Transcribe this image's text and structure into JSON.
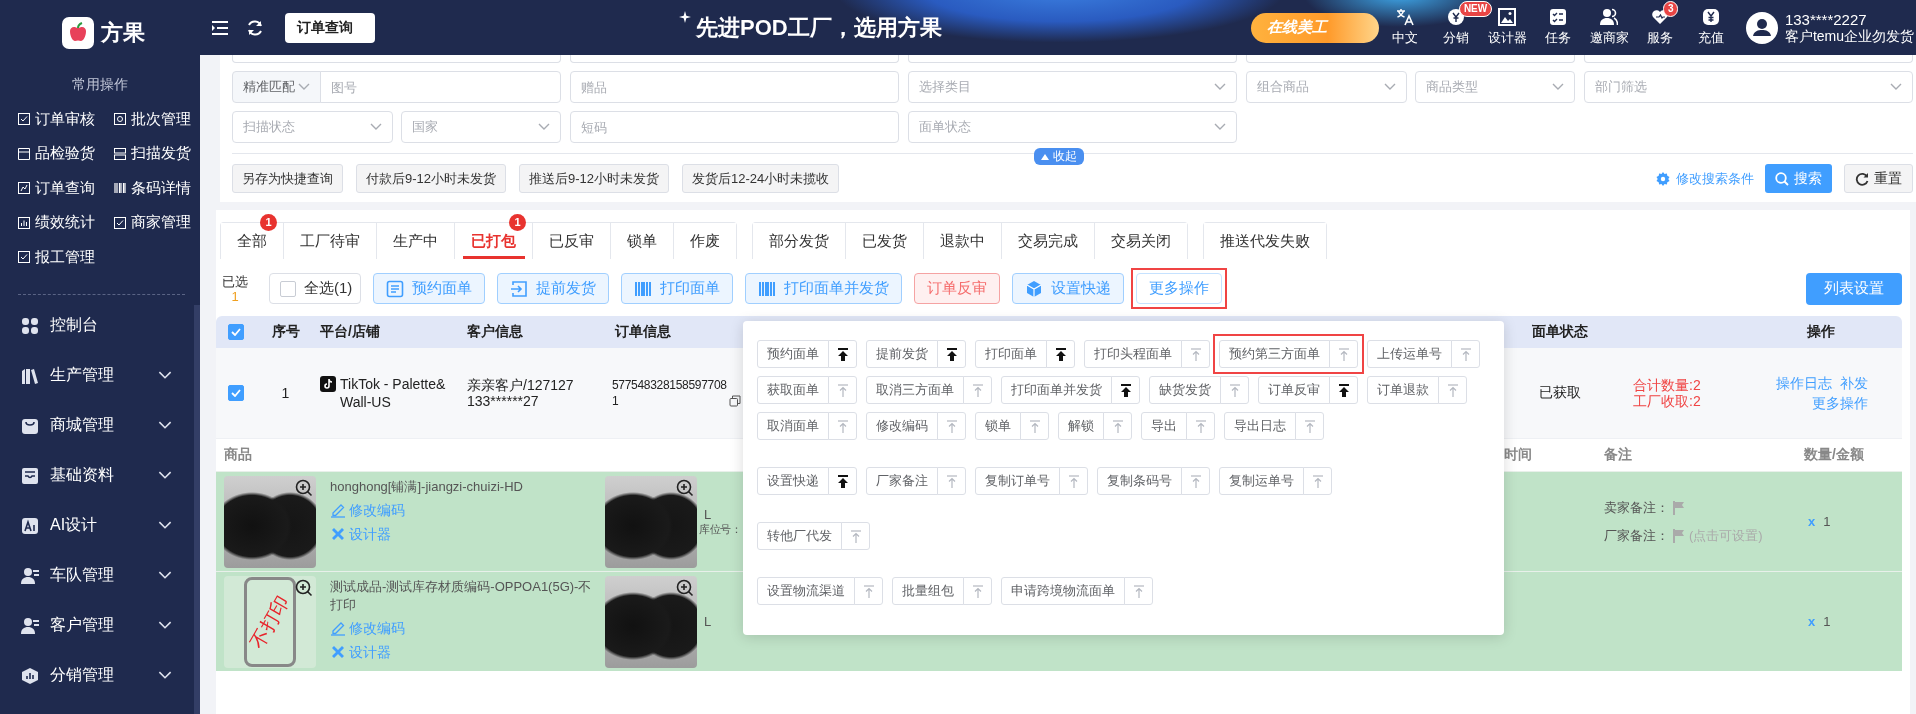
{
  "sidebar": {
    "brand": "方果",
    "section_title": "常用操作",
    "shortcuts": [
      {
        "label": "订单审核"
      },
      {
        "label": "批次管理"
      },
      {
        "label": "品检验货"
      },
      {
        "label": "扫描发货"
      },
      {
        "label": "订单查询"
      },
      {
        "label": "条码详情"
      },
      {
        "label": "绩效统计"
      },
      {
        "label": "商家管理"
      },
      {
        "label": "报工管理"
      }
    ],
    "menu": [
      {
        "label": "控制台",
        "expandable": false
      },
      {
        "label": "生产管理",
        "expandable": true
      },
      {
        "label": "商城管理",
        "expandable": true
      },
      {
        "label": "基础资料",
        "expandable": true
      },
      {
        "label": "AI设计",
        "expandable": true
      },
      {
        "label": "车队管理",
        "expandable": true
      },
      {
        "label": "客户管理",
        "expandable": true
      },
      {
        "label": "分销管理",
        "expandable": true
      }
    ]
  },
  "header": {
    "page_tab": "订单查询",
    "slogan": "先进POD工厂，选用方果",
    "promo": "在线美工",
    "tools": [
      {
        "label": "中文"
      },
      {
        "label": "分销",
        "badge": "NEW"
      },
      {
        "label": "设计器"
      },
      {
        "label": "任务"
      },
      {
        "label": "邀商家"
      },
      {
        "label": "服务",
        "badge": "3"
      },
      {
        "label": "充值"
      }
    ],
    "user": {
      "account": "133****2227",
      "company": "客户temu企业勿发货"
    }
  },
  "filters": {
    "rows": [
      [
        [
          {
            "kind": "cut"
          }
        ],
        [
          {
            "kind": "cut"
          }
        ],
        [
          {
            "kind": "cut"
          }
        ],
        [
          {
            "kind": "cut"
          }
        ],
        [
          {
            "kind": "cut"
          }
        ]
      ],
      [
        [
          {
            "kind": "match",
            "value": "精准匹配"
          },
          {
            "kind": "input",
            "placeholder": "图号"
          }
        ],
        [
          {
            "kind": "input",
            "placeholder": "赠品"
          }
        ],
        [
          {
            "kind": "select",
            "placeholder": "选择类目"
          }
        ],
        [
          {
            "kind": "select",
            "placeholder": "组合商品"
          },
          {
            "kind": "select",
            "placeholder": "商品类型"
          }
        ],
        [
          {
            "kind": "select",
            "placeholder": "部门筛选"
          }
        ]
      ],
      [
        [
          {
            "kind": "select",
            "placeholder": "扫描状态"
          },
          {
            "kind": "select",
            "placeholder": "国家"
          }
        ],
        [
          {
            "kind": "input",
            "placeholder": "短码"
          }
        ],
        [
          {
            "kind": "select",
            "placeholder": "面单状态"
          }
        ]
      ]
    ],
    "collapse": "收起",
    "quick_queries": [
      "另存为快捷查询",
      "付款后9-12小时未发货",
      "推送后9-12小时未发货",
      "发货后12-24小时未揽收"
    ],
    "edit_conditions": "修改搜索条件",
    "search": "搜索",
    "reset": "重置"
  },
  "tabs": {
    "groups": [
      [
        {
          "label": "全部",
          "badge": "1",
          "selected": false
        },
        {
          "label": "工厂待审",
          "selected": false
        },
        {
          "label": "生产中",
          "selected": false
        },
        {
          "label": "已打包",
          "badge": "1",
          "selected": true
        },
        {
          "label": "已反审",
          "selected": false
        },
        {
          "label": "锁单",
          "selected": false
        },
        {
          "label": "作废",
          "selected": false
        }
      ],
      [
        {
          "label": "部分发货",
          "selected": false
        },
        {
          "label": "已发货",
          "selected": false
        },
        {
          "label": "退款中",
          "selected": false
        },
        {
          "label": "交易完成",
          "selected": false
        },
        {
          "label": "交易关闭",
          "selected": false
        }
      ],
      [
        {
          "label": "推送代发失败",
          "selected": false
        }
      ]
    ]
  },
  "toolbar": {
    "selected_label": "已选",
    "selected_count": "1",
    "select_all": {
      "label": "全选(1)",
      "checked": false
    },
    "buttons": [
      {
        "label": "预约面单",
        "kind": "light",
        "highlighted": false
      },
      {
        "label": "提前发货",
        "kind": "light",
        "highlighted": false
      },
      {
        "label": "打印面单",
        "kind": "light",
        "highlighted": false
      },
      {
        "label": "打印面单并发货",
        "kind": "light",
        "highlighted": false
      },
      {
        "label": "订单反审",
        "kind": "danger",
        "highlighted": false
      },
      {
        "label": "设置快递",
        "kind": "light",
        "highlighted": false
      },
      {
        "label": "更多操作",
        "kind": "outline",
        "highlighted": true
      }
    ],
    "list_settings": "列表设置"
  },
  "table": {
    "all_checked": true,
    "columns": [
      {
        "label": "序号"
      },
      {
        "label": "平台/店铺"
      },
      {
        "label": "客户信息"
      },
      {
        "label": "订单信息"
      },
      {
        "label": "面单状态"
      },
      {
        "label": "操作"
      }
    ],
    "order": {
      "checked": true,
      "index": "1",
      "platform": "TikTok - Palette&Wall-US",
      "customer": "亲亲客户/127127",
      "phone": "133******27",
      "order_no": "5775483281585977081",
      "waybill_status": "已获取",
      "totals": [
        "合计数量:2",
        "工厂收取:2"
      ],
      "operations": [
        "操作日志",
        "补发",
        "更多操作"
      ]
    },
    "item_columns": [
      {
        "label": "商品"
      },
      {
        "label": "时间"
      },
      {
        "label": "备注"
      },
      {
        "label": "数量/金额"
      }
    ],
    "items": [
      {
        "name": "honghong[铺满]-jiangzi-chuizi-HD",
        "print": true,
        "edit_code": "修改编码",
        "designer": "设计器",
        "size": "L",
        "location_label": "库位号：",
        "seller_note": "卖家备注：",
        "factory_note": "厂家备注：",
        "factory_note_hint": "(点击可设置)",
        "quantity_mark": "x",
        "quantity": "1"
      },
      {
        "name": "测试成品-测试库存材质编码-OPPOA1(5G)-不打印",
        "print": false,
        "print_stamp": "不打印",
        "edit_code": "修改编码",
        "designer": "设计器",
        "size": "L",
        "quantity_mark": "x",
        "quantity": "1"
      }
    ]
  },
  "more_menu": {
    "groups": [
      {
        "items": [
          {
            "label": "预约面单",
            "pinned": true,
            "highlighted": false
          },
          {
            "label": "提前发货",
            "pinned": true,
            "highlighted": false
          },
          {
            "label": "打印面单",
            "pinned": true,
            "highlighted": false
          },
          {
            "label": "打印头程面单",
            "pinned": false,
            "highlighted": false
          },
          {
            "label": "预约第三方面单",
            "pinned": false,
            "highlighted": true
          },
          {
            "label": "上传运单号",
            "pinned": false,
            "highlighted": false
          },
          {
            "label": "获取面单",
            "pinned": false,
            "highlighted": false
          },
          {
            "label": "取消三方面单",
            "pinned": false,
            "highlighted": false
          },
          {
            "label": "打印面单并发货",
            "pinned": true,
            "highlighted": false
          },
          {
            "label": "缺货发货",
            "pinned": false,
            "highlighted": false
          },
          {
            "label": "订单反审",
            "pinned": true,
            "highlighted": false
          },
          {
            "label": "订单退款",
            "pinned": false,
            "highlighted": false
          },
          {
            "label": "取消面单",
            "pinned": false,
            "highlighted": false
          },
          {
            "label": "修改编码",
            "pinned": false,
            "highlighted": false
          },
          {
            "label": "锁单",
            "pinned": false,
            "highlighted": false
          },
          {
            "label": "解锁",
            "pinned": false,
            "highlighted": false
          },
          {
            "label": "导出",
            "pinned": false,
            "highlighted": false
          },
          {
            "label": "导出日志",
            "pinned": false,
            "highlighted": false
          }
        ]
      },
      {
        "items": [
          {
            "label": "设置快递",
            "pinned": true,
            "highlighted": false
          },
          {
            "label": "厂家备注",
            "pinned": false,
            "highlighted": false
          },
          {
            "label": "复制订单号",
            "pinned": false,
            "highlighted": false
          },
          {
            "label": "复制条码号",
            "pinned": false,
            "highlighted": false
          },
          {
            "label": "复制运单号",
            "pinned": false,
            "highlighted": false
          }
        ]
      },
      {
        "items": [
          {
            "label": "转他厂代发",
            "pinned": false,
            "highlighted": false
          }
        ]
      },
      {
        "items": [
          {
            "label": "设置物流渠道",
            "pinned": false,
            "highlighted": false
          },
          {
            "label": "批量组包",
            "pinned": false,
            "highlighted": false
          },
          {
            "label": "申请跨境物流面单",
            "pinned": false,
            "highlighted": false
          }
        ]
      }
    ]
  }
}
